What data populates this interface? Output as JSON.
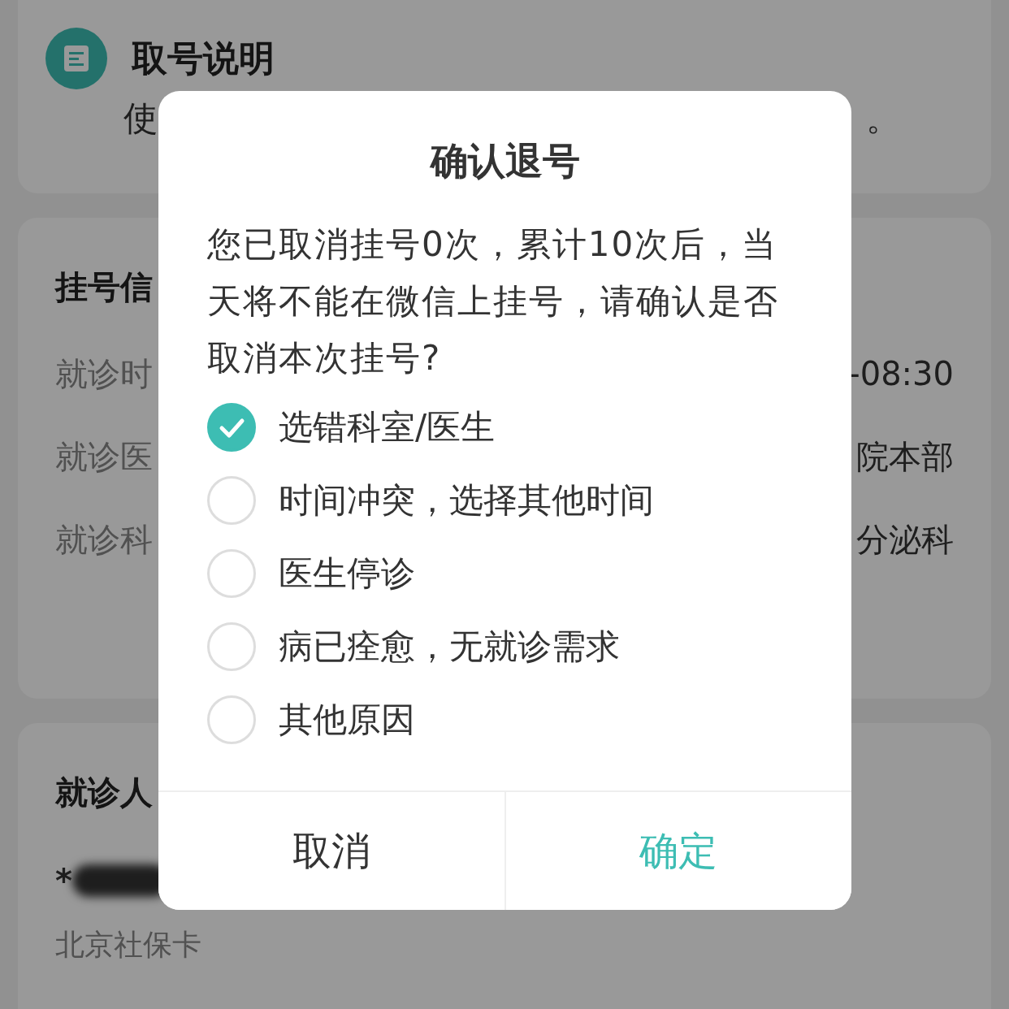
{
  "notice_card": {
    "title": "取号说明",
    "text_start": "使",
    "text_end": "。"
  },
  "registration_card": {
    "title": "挂号信",
    "rows": [
      {
        "label": "就诊时",
        "value": "-08:30"
      },
      {
        "label": "就诊医",
        "value": "院本部"
      },
      {
        "label": "就诊科",
        "value": "分泌科"
      }
    ]
  },
  "patient_card": {
    "title": "就诊人",
    "name": "*",
    "card_type": "北京社保卡"
  },
  "dialog": {
    "title": "确认退号",
    "message": "您已取消挂号0次，累计10次后，当天将不能在微信上挂号，请确认是否取消本次挂号?",
    "options": [
      {
        "label": "选错科室/医生",
        "selected": true
      },
      {
        "label": "时间冲突，选择其他时间",
        "selected": false
      },
      {
        "label": "医生停诊",
        "selected": false
      },
      {
        "label": "病已痊愈，无就诊需求",
        "selected": false
      },
      {
        "label": "其他原因",
        "selected": false
      }
    ],
    "buttons": [
      {
        "label": "取消",
        "kind": "cancel"
      },
      {
        "label": "确定",
        "kind": "confirm"
      }
    ]
  }
}
